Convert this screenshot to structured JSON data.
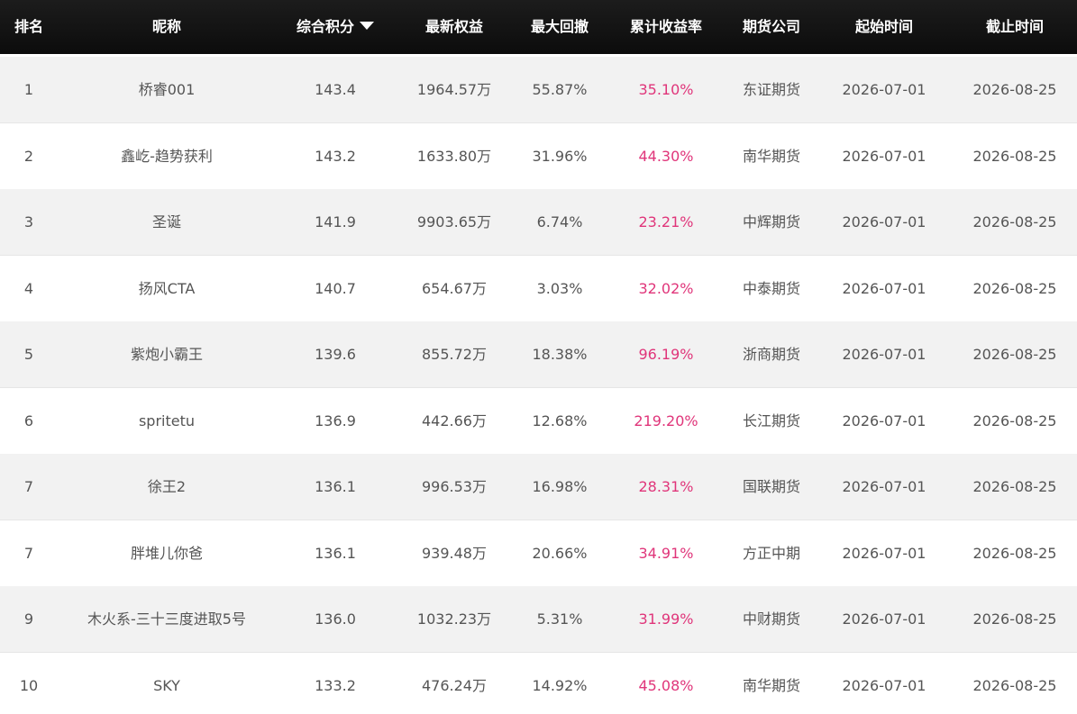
{
  "table": {
    "headers": {
      "rank": "排名",
      "nickname": "昵称",
      "score": "综合积分",
      "equity": "最新权益",
      "max_drawdown": "最大回撤",
      "cumulative_return": "累计收益率",
      "futures_company": "期货公司",
      "start_time": "起始时间",
      "end_time": "截止时间"
    },
    "sort_icon": "sort-desc-triangle-icon",
    "rows": [
      {
        "rank": "1",
        "nickname": "桥睿001",
        "score": "143.4",
        "equity": "1964.57万",
        "max_drawdown": "55.87%",
        "cumulative_return": "35.10%",
        "futures_company": "东证期货",
        "start_time": "2026-07-01",
        "end_time": "2026-08-25"
      },
      {
        "rank": "2",
        "nickname": "鑫屹-趋势获利",
        "score": "143.2",
        "equity": "1633.80万",
        "max_drawdown": "31.96%",
        "cumulative_return": "44.30%",
        "futures_company": "南华期货",
        "start_time": "2026-07-01",
        "end_time": "2026-08-25"
      },
      {
        "rank": "3",
        "nickname": "圣诞",
        "score": "141.9",
        "equity": "9903.65万",
        "max_drawdown": "6.74%",
        "cumulative_return": "23.21%",
        "futures_company": "中辉期货",
        "start_time": "2026-07-01",
        "end_time": "2026-08-25"
      },
      {
        "rank": "4",
        "nickname": "扬风CTA",
        "score": "140.7",
        "equity": "654.67万",
        "max_drawdown": "3.03%",
        "cumulative_return": "32.02%",
        "futures_company": "中泰期货",
        "start_time": "2026-07-01",
        "end_time": "2026-08-25"
      },
      {
        "rank": "5",
        "nickname": "紫炮小霸王",
        "score": "139.6",
        "equity": "855.72万",
        "max_drawdown": "18.38%",
        "cumulative_return": "96.19%",
        "futures_company": "浙商期货",
        "start_time": "2026-07-01",
        "end_time": "2026-08-25"
      },
      {
        "rank": "6",
        "nickname": "spritetu",
        "score": "136.9",
        "equity": "442.66万",
        "max_drawdown": "12.68%",
        "cumulative_return": "219.20%",
        "futures_company": "长江期货",
        "start_time": "2026-07-01",
        "end_time": "2026-08-25"
      },
      {
        "rank": "7",
        "nickname": "徐王2",
        "score": "136.1",
        "equity": "996.53万",
        "max_drawdown": "16.98%",
        "cumulative_return": "28.31%",
        "futures_company": "国联期货",
        "start_time": "2026-07-01",
        "end_time": "2026-08-25"
      },
      {
        "rank": "7",
        "nickname": "胖堆儿你爸",
        "score": "136.1",
        "equity": "939.48万",
        "max_drawdown": "20.66%",
        "cumulative_return": "34.91%",
        "futures_company": "方正中期",
        "start_time": "2026-07-01",
        "end_time": "2026-08-25"
      },
      {
        "rank": "9",
        "nickname": "木火系-三十三度进取5号",
        "score": "136.0",
        "equity": "1032.23万",
        "max_drawdown": "5.31%",
        "cumulative_return": "31.99%",
        "futures_company": "中财期货",
        "start_time": "2026-07-01",
        "end_time": "2026-08-25"
      },
      {
        "rank": "10",
        "nickname": "SKY",
        "score": "133.2",
        "equity": "476.24万",
        "max_drawdown": "14.92%",
        "cumulative_return": "45.08%",
        "futures_company": "南华期货",
        "start_time": "2026-07-01",
        "end_time": "2026-08-25"
      }
    ]
  },
  "colors": {
    "header_bg": "#111111",
    "header_text": "#ffffff",
    "row_shaded": "#f2f2f2",
    "row_plain": "#ffffff",
    "return_text": "#e0357a",
    "body_text": "#555555"
  }
}
